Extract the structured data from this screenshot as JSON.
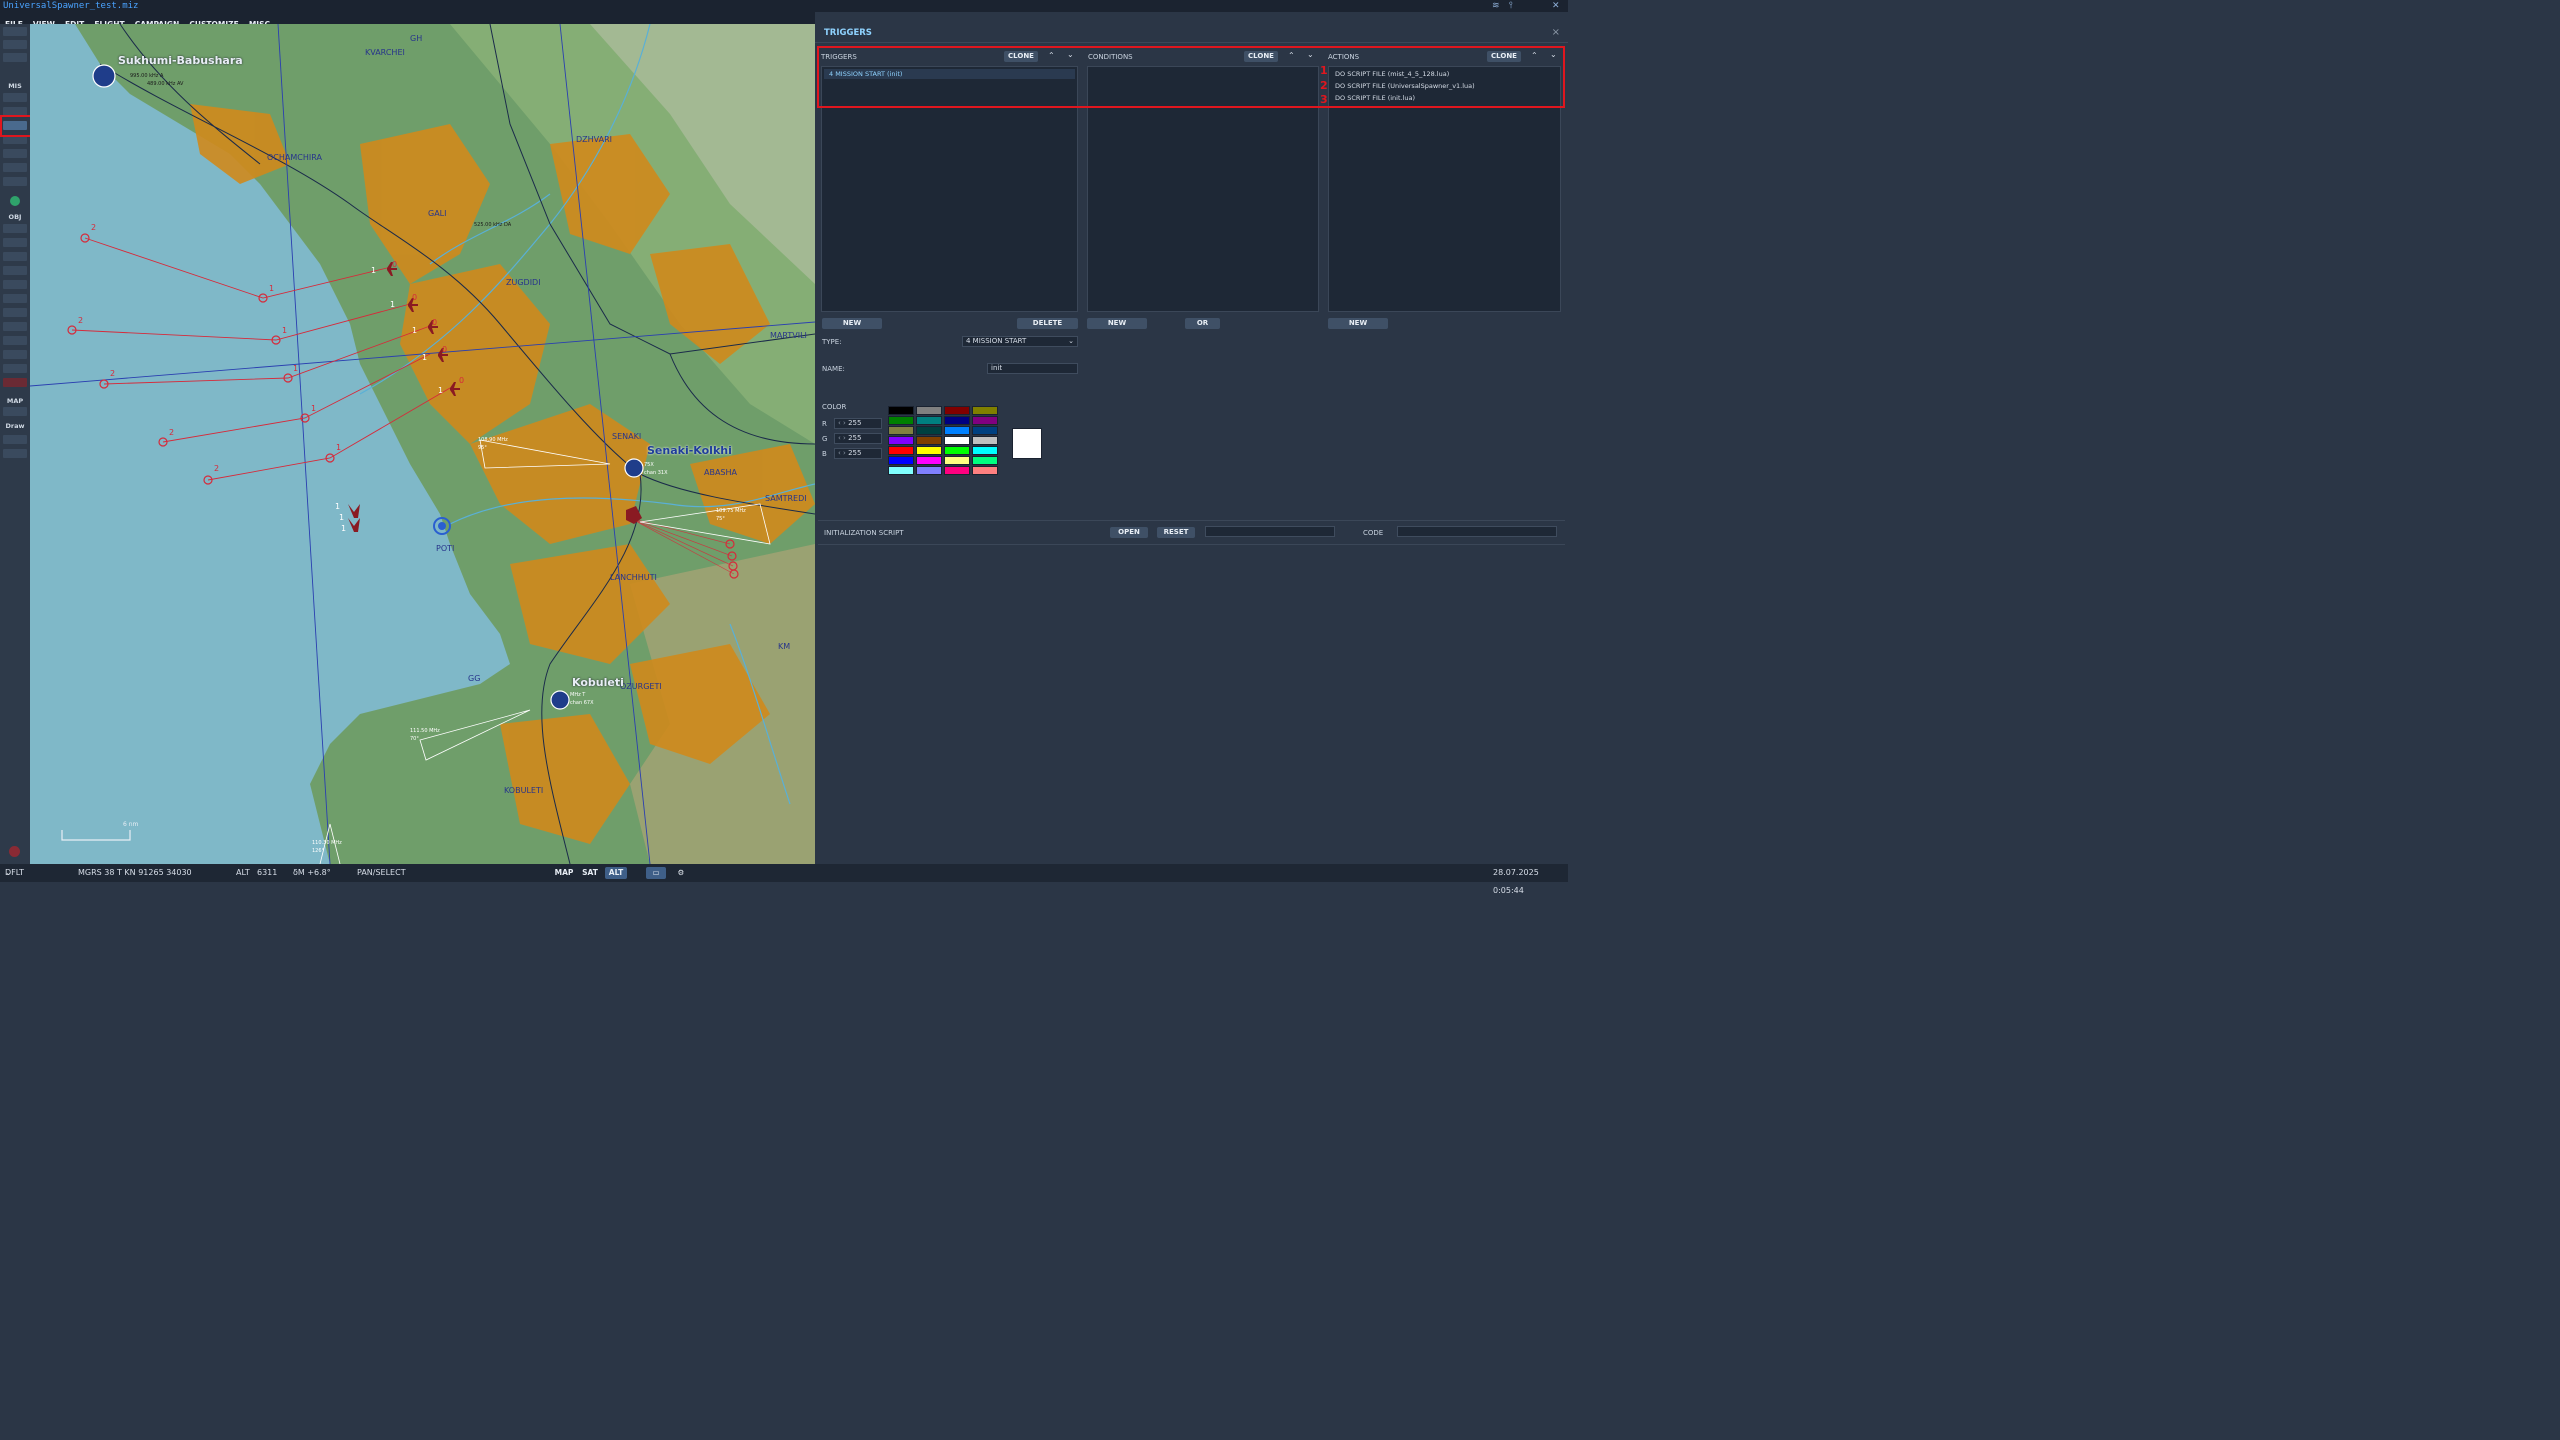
{
  "window": {
    "title": "UniversalSpawner_test.miz"
  },
  "menu": [
    "FILE",
    "VIEW",
    "EDIT",
    "FLIGHT",
    "CAMPAIGN",
    "CUSTOMIZE",
    "MISC"
  ],
  "toolbar": {
    "sections": {
      "mis": "MIS",
      "obj": "OBJ",
      "map": "MAP",
      "draw": "Draw"
    }
  },
  "map": {
    "labels": {
      "gh": "GH",
      "kvarchei": "KVARCHEI",
      "ochamchira": "OCHAMCHIRA",
      "dzhvari": "DZHVARI",
      "gali": "GALI",
      "zugdidi": "ZUGDIDI",
      "martvili": "MARTVILI",
      "senaki": "SENAKI",
      "abasha": "ABASHA",
      "samtredi": "SAMTREDI",
      "poti": "POTI",
      "lanchhuti": "LANCHHUTI",
      "km": "KM",
      "gg": "GG",
      "ozurgeti": "OZURGETI",
      "kobuleti_town": "KOBULETI"
    },
    "airbases": {
      "sukhumi": "Sukhumi-Babushara",
      "senaki": "Senaki-Kolkhi",
      "kobuleti": "Kobuleti"
    },
    "freqs": {
      "sukhumi1": "995.00 kHz A",
      "sukhumi2": "489.00 kHz AV",
      "gali": "525.00 kHz DA",
      "senaki1": "108.90 MHz",
      "senaki2": "95°",
      "senaki3": "chan 31X",
      "senaki4": "75X",
      "samtredi1": "109.75 MHz",
      "samtredi2": "75°",
      "kobuleti1": "111.50 MHz",
      "kobuleti2": "70°",
      "kobuleti3": "MHz T",
      "kobuleti4": "chan 67X",
      "bottom1": "110.30 MHz",
      "bottom2": "126°"
    },
    "scale": "6 nm",
    "wp": {
      "one": "1",
      "two": "2",
      "zero": "0"
    }
  },
  "triggers_panel": {
    "title": "TRIGGERS",
    "close": "×",
    "columns": {
      "triggers": {
        "header": "TRIGGERS",
        "clone": "CLONE",
        "items": [
          "4 MISSION START (init)"
        ],
        "new": "NEW",
        "delete": "DELETE"
      },
      "conditions": {
        "header": "CONDITIONS",
        "clone": "CLONE",
        "items": [],
        "new": "NEW",
        "or": "OR"
      },
      "actions": {
        "header": "ACTIONS",
        "clone": "CLONE",
        "items": [
          "DO SCRIPT FILE (mist_4_5_128.lua)",
          "DO SCRIPT FILE (UniversalSpawner_v1.lua)",
          "DO SCRIPT FILE (init.lua)"
        ],
        "new": "NEW"
      }
    },
    "annotations": [
      "1",
      "2",
      "3"
    ],
    "type": {
      "label": "TYPE:",
      "value": "4 MISSION START"
    },
    "name": {
      "label": "NAME:",
      "value": "init"
    },
    "color": {
      "label": "COLOR",
      "r_label": "R",
      "r": "255",
      "g_label": "G",
      "g": "255",
      "b_label": "B",
      "b": "255",
      "palette": [
        "#000000",
        "#808080",
        "#800000",
        "#808000",
        "#008000",
        "#008080",
        "#000080",
        "#800080",
        "#808040",
        "#004040",
        "#0080ff",
        "#004080",
        "#8000ff",
        "#804000",
        "#ffffff",
        "#c0c0c0",
        "#ff0000",
        "#ffff00",
        "#00ff00",
        "#00ffff",
        "#0000ff",
        "#ff00ff",
        "#ffff80",
        "#00ff80",
        "#80ffff",
        "#8080ff",
        "#ff0080",
        "#ff8080"
      ],
      "preview": "#ffffff"
    },
    "init_script": {
      "label": "INITIALIZATION SCRIPT",
      "open": "OPEN",
      "reset": "RESET",
      "code_label": "CODE"
    }
  },
  "status": {
    "profile": "DFLT",
    "mgrs": "MGRS  38 T KN 91265 34030",
    "alt_label": "ALT",
    "alt": "6311",
    "mag": "δM  +6.8°",
    "mode": "PAN/SELECT",
    "map_btn": "MAP",
    "sat_btn": "SAT",
    "alt_btn": "ALT",
    "datetime": "28.07.2025 0:05:44"
  },
  "colors": {
    "accent": "#8fd3ff",
    "annotation": "#e0161e",
    "land": "#6f9e6a",
    "urban": "#d08a1c",
    "sea": "#7fb8c8"
  }
}
